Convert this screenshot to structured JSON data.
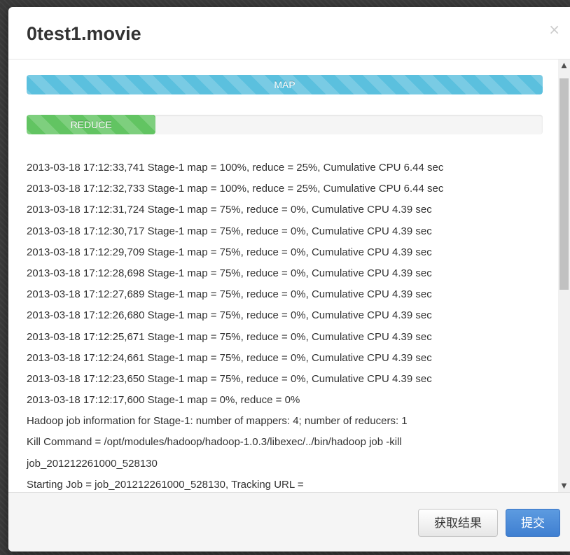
{
  "modal": {
    "title": "0test1.movie",
    "close_label": "×"
  },
  "progress": {
    "map": {
      "label": "MAP",
      "value": 1.0,
      "color": "#5bc0de"
    },
    "reduce": {
      "label": "REDUCE",
      "value": 0.25,
      "color": "#62c462"
    }
  },
  "log": {
    "lines": [
      "2013-03-18 17:12:33,741 Stage-1 map = 100%, reduce = 25%, Cumulative CPU 6.44 sec",
      "2013-03-18 17:12:32,733 Stage-1 map = 100%, reduce = 25%, Cumulative CPU 6.44 sec",
      "2013-03-18 17:12:31,724 Stage-1 map = 75%, reduce = 0%, Cumulative CPU 4.39 sec",
      "2013-03-18 17:12:30,717 Stage-1 map = 75%, reduce = 0%, Cumulative CPU 4.39 sec",
      "2013-03-18 17:12:29,709 Stage-1 map = 75%, reduce = 0%, Cumulative CPU 4.39 sec",
      "2013-03-18 17:12:28,698 Stage-1 map = 75%, reduce = 0%, Cumulative CPU 4.39 sec",
      "2013-03-18 17:12:27,689 Stage-1 map = 75%, reduce = 0%, Cumulative CPU 4.39 sec",
      "2013-03-18 17:12:26,680 Stage-1 map = 75%, reduce = 0%, Cumulative CPU 4.39 sec",
      "2013-03-18 17:12:25,671 Stage-1 map = 75%, reduce = 0%, Cumulative CPU 4.39 sec",
      "2013-03-18 17:12:24,661 Stage-1 map = 75%, reduce = 0%, Cumulative CPU 4.39 sec",
      "2013-03-18 17:12:23,650 Stage-1 map = 75%, reduce = 0%, Cumulative CPU 4.39 sec",
      "2013-03-18 17:12:17,600 Stage-1 map = 0%, reduce = 0%",
      "Hadoop job information for Stage-1: number of mappers: 4; number of reducers: 1",
      "Kill Command = /opt/modules/hadoop/hadoop-1.0.3/libexec/../bin/hadoop job -kill",
      "job_201212261000_528130",
      "Starting Job = job_201212261000_528130, Tracking URL ="
    ]
  },
  "scrollbar": {
    "up_icon": "▲",
    "down_icon": "▼"
  },
  "footer": {
    "fetch_results_label": "获取结果",
    "submit_label": "提交"
  }
}
